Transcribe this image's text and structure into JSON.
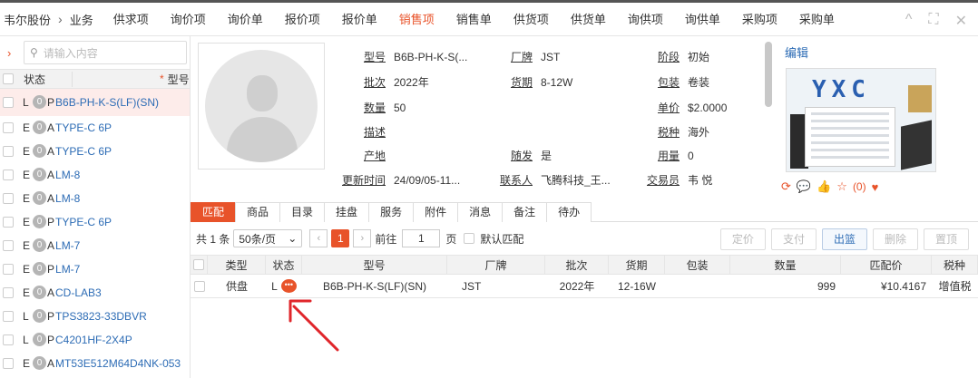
{
  "nav": {
    "crumbs": [
      "韦尔股份",
      "业务"
    ],
    "items": [
      {
        "label": "供求项",
        "active": false
      },
      {
        "label": "询价项",
        "active": false
      },
      {
        "label": "询价单",
        "active": false
      },
      {
        "label": "报价项",
        "active": false
      },
      {
        "label": "报价单",
        "active": false
      },
      {
        "label": "销售项",
        "active": true
      },
      {
        "label": "销售单",
        "active": false
      },
      {
        "label": "供货项",
        "active": false
      },
      {
        "label": "供货单",
        "active": false
      },
      {
        "label": "询供项",
        "active": false
      },
      {
        "label": "询供单",
        "active": false
      },
      {
        "label": "采购项",
        "active": false
      },
      {
        "label": "采购单",
        "active": false
      }
    ],
    "window_controls": [
      "^",
      "⛶",
      "✕"
    ]
  },
  "left": {
    "search_placeholder": "请输入内容",
    "head": {
      "status": "状态",
      "required": "*",
      "model": "型号"
    },
    "rows": [
      {
        "letter": "L",
        "count": "0",
        "prefix": "P",
        "model": "B6B-PH-K-S(LF)(SN)"
      },
      {
        "letter": "E",
        "count": "0",
        "prefix": "A",
        "model": "TYPE-C 6P"
      },
      {
        "letter": "E",
        "count": "0",
        "prefix": "A",
        "model": "TYPE-C 6P"
      },
      {
        "letter": "E",
        "count": "0",
        "prefix": "A",
        "model": "LM-8"
      },
      {
        "letter": "E",
        "count": "0",
        "prefix": "A",
        "model": "LM-8"
      },
      {
        "letter": "E",
        "count": "0",
        "prefix": "P",
        "model": "TYPE-C 6P"
      },
      {
        "letter": "E",
        "count": "0",
        "prefix": "A",
        "model": "LM-7"
      },
      {
        "letter": "E",
        "count": "0",
        "prefix": "P",
        "model": "LM-7"
      },
      {
        "letter": "E",
        "count": "0",
        "prefix": "A",
        "model": "CD-LAB3"
      },
      {
        "letter": "L",
        "count": "0",
        "prefix": "P",
        "model": "TPS3823-33DBVR"
      },
      {
        "letter": "L",
        "count": "0",
        "prefix": "P",
        "model": "C4201HF-2X4P"
      },
      {
        "letter": "E",
        "count": "0",
        "prefix": "A",
        "model": "MT53E512M64D4NK-053"
      }
    ]
  },
  "detail": {
    "fields": {
      "model": {
        "label": "型号",
        "value": "B6B-PH-K-S(..."
      },
      "brand": {
        "label": "厂牌",
        "value": "JST"
      },
      "stage": {
        "label": "阶段",
        "value": "初始"
      },
      "batch": {
        "label": "批次",
        "value": "2022年"
      },
      "leadtime": {
        "label": "货期",
        "value": "8-12W"
      },
      "package": {
        "label": "包装",
        "value": "卷装"
      },
      "qty": {
        "label": "数量",
        "value": "50"
      },
      "unitprice": {
        "label": "单价",
        "value": "$2.0000"
      },
      "desc": {
        "label": "描述",
        "value": ""
      },
      "tax": {
        "label": "税种",
        "value": "海外"
      },
      "origin": {
        "label": "产地",
        "value": ""
      },
      "suifa": {
        "label": "随发",
        "value": "是"
      },
      "usage": {
        "label": "用量",
        "value": "0"
      },
      "updated": {
        "label": "更新时间",
        "value": "24/09/05-11..."
      },
      "contact": {
        "label": "联系人",
        "value": "飞腾科技_王..."
      },
      "trader": {
        "label": "交易员",
        "value": "韦 悦"
      }
    },
    "edit_label": "编辑",
    "banner_logo": "YXC",
    "like_count": "(0)"
  },
  "tabs": [
    "匹配",
    "商品",
    "目录",
    "挂盘",
    "服务",
    "附件",
    "消息",
    "备注",
    "待办"
  ],
  "toolbar": {
    "total": "共 1 条",
    "page_size": "50条/页",
    "current_page": "1",
    "goto_label": "前往",
    "goto_value": "1",
    "page_label": "页",
    "default_match": "默认匹配",
    "buttons": [
      {
        "label": "定价",
        "enabled": false
      },
      {
        "label": "支付",
        "enabled": false
      },
      {
        "label": "出篮",
        "enabled": true
      },
      {
        "label": "删除",
        "enabled": false
      },
      {
        "label": "置顶",
        "enabled": false
      }
    ]
  },
  "grid": {
    "columns": [
      "类型",
      "状态",
      "型号",
      "厂牌",
      "批次",
      "货期",
      "包装",
      "数量",
      "匹配价",
      "税种"
    ],
    "rows": [
      {
        "type": "供盘",
        "status": "L",
        "model": "B6B-PH-K-S(LF)(SN)",
        "brand": "JST",
        "batch": "2022年",
        "leadtime": "12-16W",
        "package": "",
        "qty": "999",
        "price": "¥10.4167",
        "tax": "增值税"
      }
    ]
  },
  "colors": {
    "accent": "#e8532a",
    "link": "#2d6cb5",
    "arrow": "#e0262b"
  }
}
